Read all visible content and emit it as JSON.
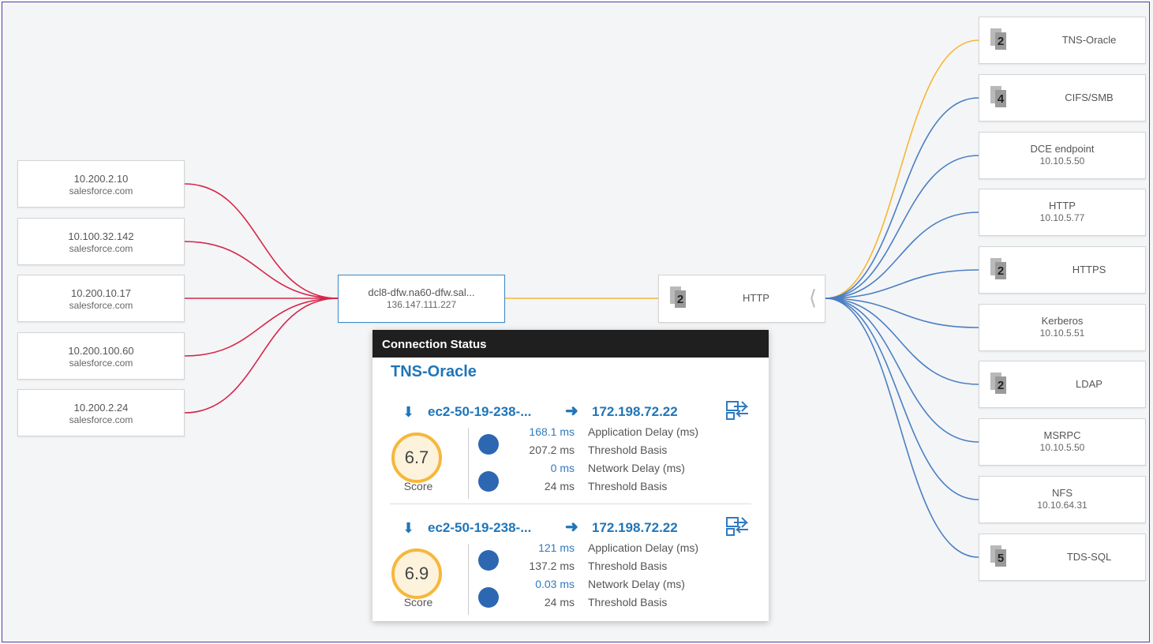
{
  "colors": {
    "client_link": "#d7274a",
    "highlight_link": "#f5b731",
    "service_link": "#4a7fc3",
    "accent": "#1f75b8"
  },
  "sources": [
    {
      "ip": "10.200.2.10",
      "host": "salesforce.com"
    },
    {
      "ip": "10.100.32.142",
      "host": "salesforce.com"
    },
    {
      "ip": "10.200.10.17",
      "host": "salesforce.com"
    },
    {
      "ip": "10.200.100.60",
      "host": "salesforce.com"
    },
    {
      "ip": "10.200.2.24",
      "host": "salesforce.com"
    }
  ],
  "center": {
    "name": "dcl8-dfw.na60-dfw.sal...",
    "ip": "136.147.111.227"
  },
  "group": {
    "label": "HTTP",
    "count": "2",
    "icon": "stack-icon",
    "expand_icon": "chevron-left-icon"
  },
  "services": [
    {
      "label": "TNS-Oracle",
      "count": "2",
      "highlight": true
    },
    {
      "label": "CIFS/SMB",
      "count": "4"
    },
    {
      "label": "DCE endpoint",
      "ip": "10.10.5.50"
    },
    {
      "label": "HTTP",
      "ip": "10.10.5.77"
    },
    {
      "label": "HTTPS",
      "count": "2"
    },
    {
      "label": "Kerberos",
      "ip": "10.10.5.51"
    },
    {
      "label": "LDAP",
      "count": "2"
    },
    {
      "label": "MSRPC",
      "ip": "10.10.5.50"
    },
    {
      "label": "NFS",
      "ip": "10.10.64.31"
    },
    {
      "label": "TDS-SQL",
      "count": "5"
    }
  ],
  "popup": {
    "header": "Connection Status",
    "title": "TNS-Oracle",
    "connections": [
      {
        "source": "ec2-50-19-238-...",
        "dest": "172.198.72.22",
        "score": "6.7",
        "score_label": "Score",
        "app_delay": "168.1 ms",
        "app_delay_label": "Application Delay (ms)",
        "app_threshold": "207.2 ms",
        "app_threshold_label": "Threshold Basis",
        "net_delay": "0 ms",
        "net_delay_label": "Network Delay (ms)",
        "net_threshold": "24 ms",
        "net_threshold_label": "Threshold Basis"
      },
      {
        "source": "ec2-50-19-238-...",
        "dest": "172.198.72.22",
        "score": "6.9",
        "score_label": "Score",
        "app_delay": "121 ms",
        "app_delay_label": "Application Delay (ms)",
        "app_threshold": "137.2 ms",
        "app_threshold_label": "Threshold Basis",
        "net_delay": "0.03 ms",
        "net_delay_label": "Network Delay (ms)",
        "net_threshold": "24 ms",
        "net_threshold_label": "Threshold Basis"
      }
    ]
  }
}
